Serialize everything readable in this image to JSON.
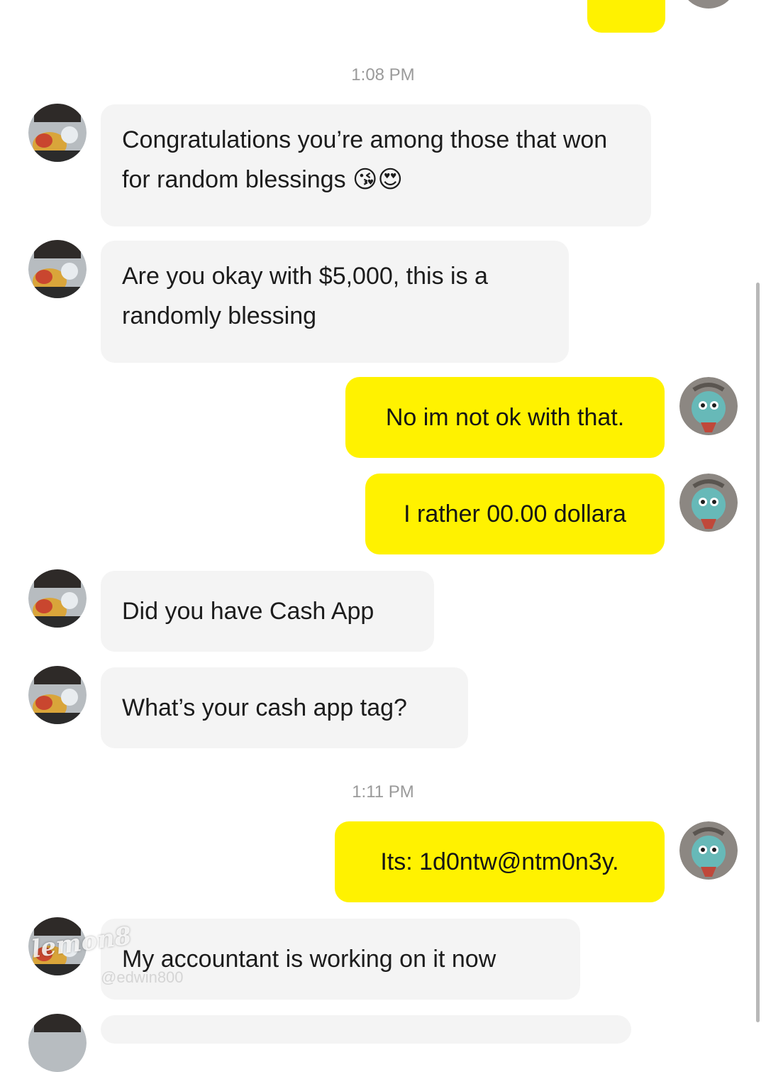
{
  "conversation": {
    "timestamps": [
      "1:08 PM",
      "1:11 PM"
    ],
    "top_partial_bubble_text": "",
    "messages": [
      {
        "sender": "them",
        "text": "Congratulations you’re among those that won for random blessings 😘😍"
      },
      {
        "sender": "them",
        "text": "Are you okay with $5,000, this is a randomly blessing"
      },
      {
        "sender": "me",
        "text": "No im not ok with that."
      },
      {
        "sender": "me",
        "text": "I rather 00.00 dollara"
      },
      {
        "sender": "them",
        "text": "Did you have Cash App"
      },
      {
        "sender": "them",
        "text": "What’s your cash app tag?"
      },
      {
        "sender": "me",
        "text": "Its: 1d0ntw@ntm0n3y."
      },
      {
        "sender": "them",
        "text": "My accountant is working on it now"
      }
    ]
  },
  "colors": {
    "my_bubble": "#fff200",
    "their_bubble": "#f4f4f4",
    "timestamp": "#9a9a9a"
  },
  "watermark": {
    "brand": "lemon8",
    "handle": "@edwin800"
  }
}
